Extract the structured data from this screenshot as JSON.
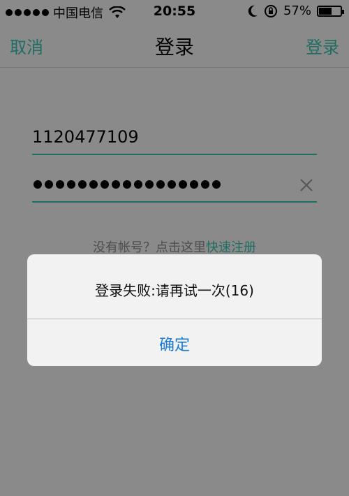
{
  "status_bar": {
    "carrier": "中国电信",
    "time": "20:55",
    "battery_percent": "57%",
    "battery_level": 0.57,
    "icons": [
      "signal-dots",
      "wifi-icon",
      "moon-icon",
      "rotation-lock-icon",
      "battery-icon"
    ]
  },
  "nav": {
    "cancel_label": "取消",
    "title": "登录",
    "login_label": "登录"
  },
  "form": {
    "username_value": "1120477109",
    "password_mask_count": 17,
    "clear_icon": "close-icon"
  },
  "register": {
    "prompt": "没有帐号？点击这里",
    "link": "快速注册"
  },
  "alert": {
    "message": "登录失败:请再试一次(16)",
    "confirm_label": "确定"
  },
  "colors": {
    "accent": "#1f6d63",
    "overlay_bg": "#8a8a8a",
    "alert_button": "#1a7bd1"
  }
}
